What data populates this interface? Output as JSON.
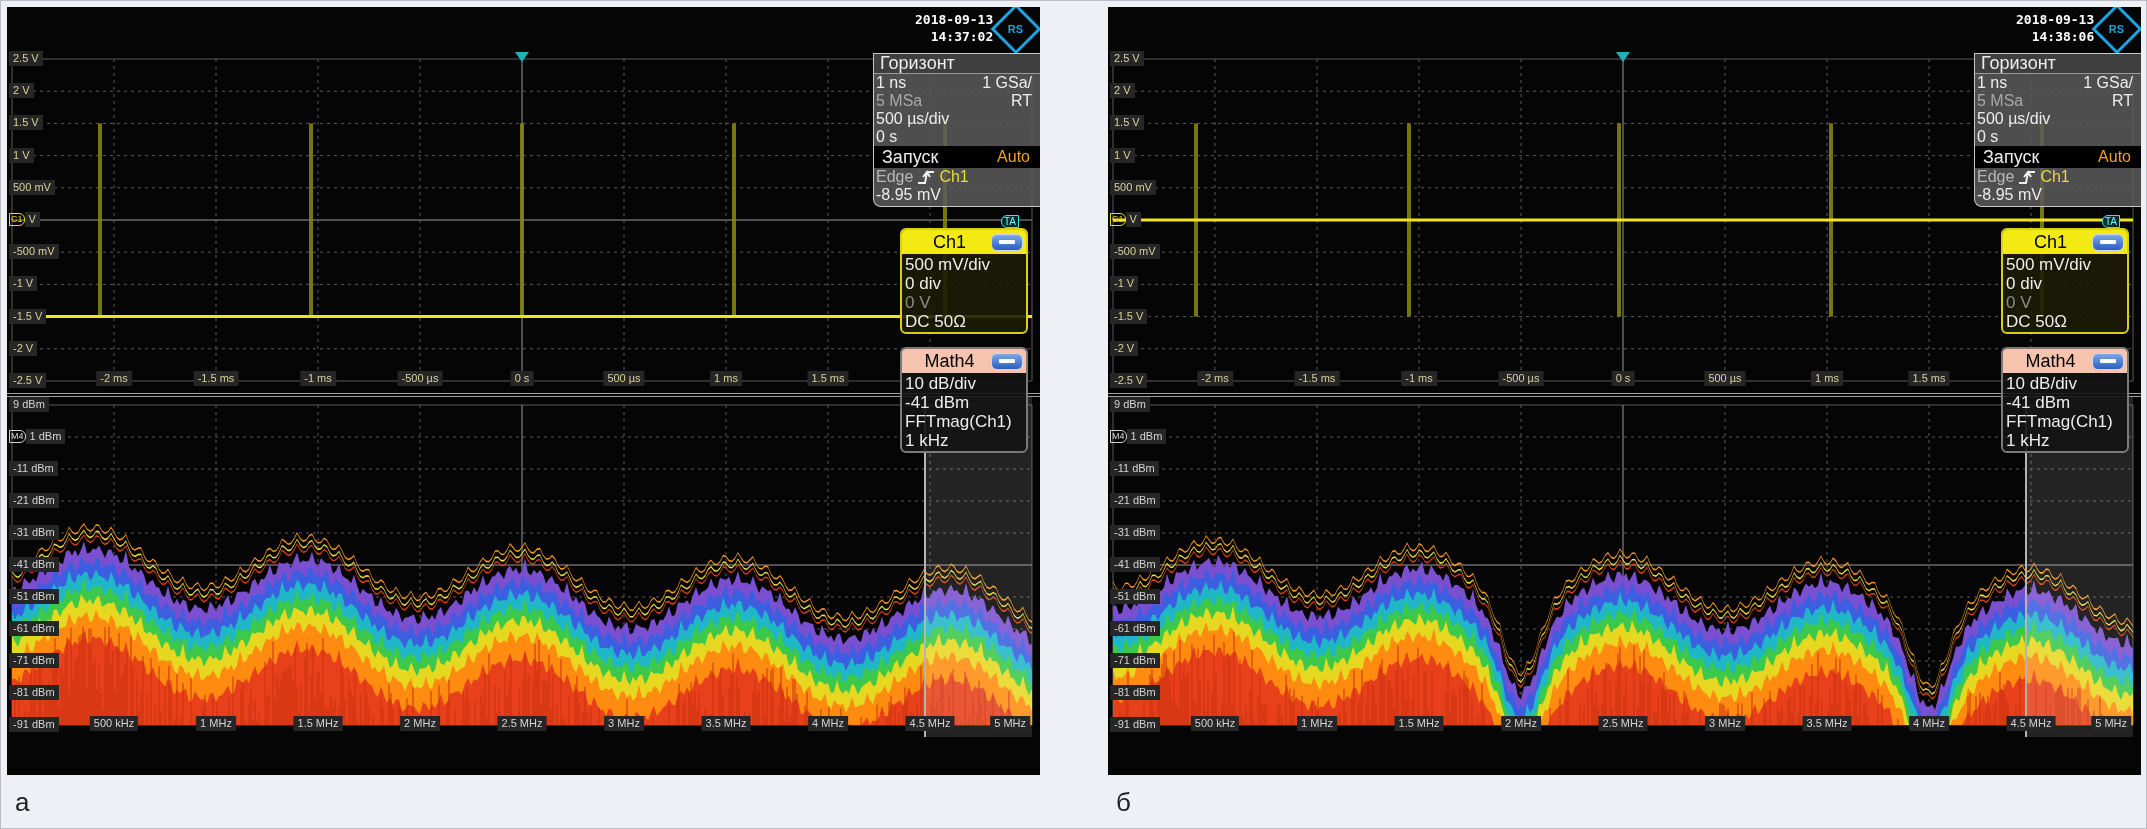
{
  "panels": [
    {
      "caption": "а",
      "screen": {
        "date": "2018-09-13",
        "time": "14:37:02",
        "logo": "RS",
        "time_plot": {
          "trigger_marker": "TA",
          "y_labels": [
            {
              "text": "2.5 V"
            },
            {
              "text": "2 V"
            },
            {
              "text": "1.5 V"
            },
            {
              "text": "1 V"
            },
            {
              "text": "500 mV"
            },
            {
              "text": "V",
              "marker": "C1"
            },
            {
              "text": "-500 mV"
            },
            {
              "text": "-1 V"
            },
            {
              "text": "-1.5 V"
            },
            {
              "text": "-2 V"
            },
            {
              "text": "-2.5 V"
            }
          ],
          "x_labels": [
            "-2 ms",
            "-1.5 ms",
            "-1 ms",
            "-500 µs",
            "0 s",
            "500 µs",
            "1 ms",
            "1.5 ms"
          ]
        },
        "fft_plot": {
          "y_labels": [
            {
              "text": "9 dBm"
            },
            {
              "text": "1 dBm",
              "marker": "M4"
            },
            {
              "text": "-11 dBm"
            },
            {
              "text": "-21 dBm"
            },
            {
              "text": "-31 dBm"
            },
            {
              "text": "-41 dBm"
            },
            {
              "text": "-51 dBm"
            },
            {
              "text": "-61 dBm"
            },
            {
              "text": "-71 dBm"
            },
            {
              "text": "-81 dBm"
            },
            {
              "text": "-91 dBm"
            }
          ],
          "x_labels": [
            "500 kHz",
            "1 MHz",
            "1.5 MHz",
            "2 MHz",
            "2.5 MHz",
            "3 MHz",
            "3.5 MHz",
            "4 MHz",
            "4.5 MHz",
            "5 MHz"
          ]
        },
        "horizontal": {
          "title": "Горизонт",
          "rows": [
            {
              "text": "1 ns",
              "dim": false,
              "right": "1 GSa/"
            },
            {
              "text": "5 MSa",
              "dim": true,
              "right": "RT"
            },
            {
              "text": "500 µs/div",
              "dim": false
            },
            {
              "text": "0 s",
              "dim": false
            }
          ]
        },
        "trigger": {
          "title": "Запуск",
          "mode": "Auto",
          "type": "Edge",
          "source": "Ch1",
          "value": "-8.95 mV"
        },
        "channels": [
          {
            "kind": "analog",
            "name": "Ch1",
            "lines": [
              {
                "text": "500 mV/div",
                "dim": false
              },
              {
                "text": "0 div",
                "dim": false
              },
              {
                "text": "0 V",
                "dim": true
              },
              {
                "text": "DC 50Ω",
                "dim": false
              }
            ]
          },
          {
            "kind": "math",
            "name": "Math4",
            "lines": [
              {
                "text": "10 dB/div",
                "dim": false
              },
              {
                "text": "-41 dBm",
                "dim": false
              },
              {
                "text": "FFTmag(Ch1)",
                "dim": false
              },
              {
                "text": "1 kHz",
                "dim": false
              }
            ]
          }
        ]
      }
    },
    {
      "caption": "б",
      "screen": {
        "date": "2018-09-13",
        "time": "14:38:06",
        "logo": "RS",
        "time_plot": {
          "trigger_marker": "TA",
          "y_labels": [
            {
              "text": "2.5 V"
            },
            {
              "text": "2 V"
            },
            {
              "text": "1.5 V"
            },
            {
              "text": "1 V"
            },
            {
              "text": "500 mV"
            },
            {
              "text": "V",
              "marker": "C1"
            },
            {
              "text": "-500 mV"
            },
            {
              "text": "-1 V"
            },
            {
              "text": "-1.5 V"
            },
            {
              "text": "-2 V"
            },
            {
              "text": "-2.5 V"
            }
          ],
          "x_labels": [
            "-2 ms",
            "-1.5 ms",
            "-1 ms",
            "-500 µs",
            "0 s",
            "500 µs",
            "1 ms",
            "1.5 ms"
          ]
        },
        "fft_plot": {
          "y_labels": [
            {
              "text": "9 dBm"
            },
            {
              "text": "1 dBm",
              "marker": "M4"
            },
            {
              "text": "-11 dBm"
            },
            {
              "text": "-21 dBm"
            },
            {
              "text": "-31 dBm"
            },
            {
              "text": "-41 dBm"
            },
            {
              "text": "-51 dBm"
            },
            {
              "text": "-61 dBm"
            },
            {
              "text": "-71 dBm"
            },
            {
              "text": "-81 dBm"
            },
            {
              "text": "-91 dBm"
            }
          ],
          "x_labels": [
            "500 kHz",
            "1 MHz",
            "1.5 MHz",
            "2 MHz",
            "2.5 MHz",
            "3 MHz",
            "3.5 MHz",
            "4 MHz",
            "4.5 MHz",
            "5 MHz"
          ]
        },
        "horizontal": {
          "title": "Горизонт",
          "rows": [
            {
              "text": "1 ns",
              "dim": false,
              "right": "1 GSa/"
            },
            {
              "text": "5 MSa",
              "dim": true,
              "right": "RT"
            },
            {
              "text": "500 µs/div",
              "dim": false
            },
            {
              "text": "0 s",
              "dim": false
            }
          ]
        },
        "trigger": {
          "title": "Запуск",
          "mode": "Auto",
          "type": "Edge",
          "source": "Ch1",
          "value": "-8.95 mV"
        },
        "channels": [
          {
            "kind": "analog",
            "name": "Ch1",
            "lines": [
              {
                "text": "500 mV/div",
                "dim": false
              },
              {
                "text": "0 div",
                "dim": false
              },
              {
                "text": "0 V",
                "dim": true
              },
              {
                "text": "DC 50Ω",
                "dim": false
              }
            ]
          },
          {
            "kind": "math",
            "name": "Math4",
            "lines": [
              {
                "text": "10 dB/div",
                "dim": false
              },
              {
                "text": "-41 dBm",
                "dim": false
              },
              {
                "text": "FFTmag(Ch1)",
                "dim": false
              },
              {
                "text": "1 kHz",
                "dim": false
              }
            ]
          }
        ]
      }
    }
  ]
}
